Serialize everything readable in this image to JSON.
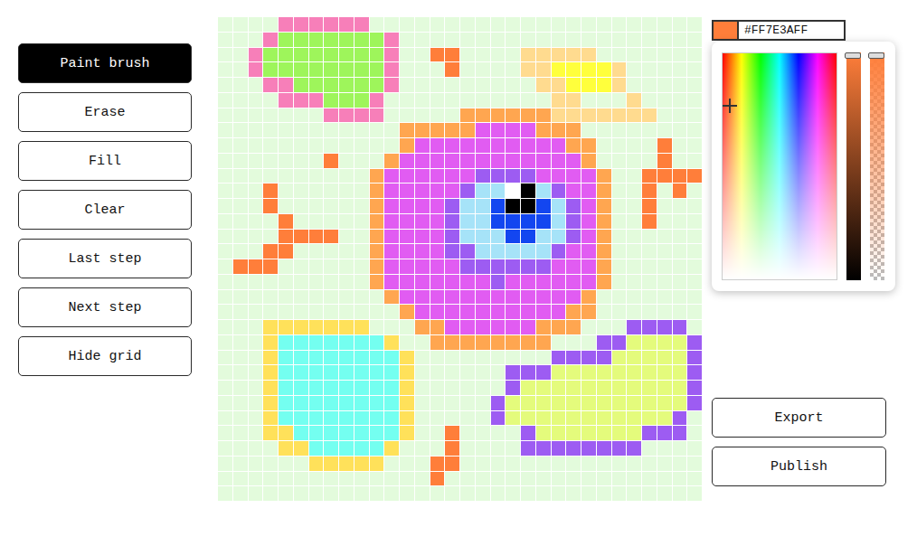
{
  "tools": [
    {
      "label": "Paint brush",
      "selected": true
    },
    {
      "label": "Erase",
      "selected": false
    },
    {
      "label": "Fill",
      "selected": false
    },
    {
      "label": "Clear",
      "selected": false
    },
    {
      "label": "Last step",
      "selected": false
    },
    {
      "label": "Next step",
      "selected": false
    },
    {
      "label": "Hide grid",
      "selected": false
    }
  ],
  "color": {
    "hex": "#FF7E3AFF"
  },
  "picker": {
    "open": true,
    "x": 0.06,
    "y": 0.23,
    "shade": 1,
    "alpha": 1
  },
  "canvas": {
    "palette": {
      ".": "#e3fbdc",
      "p": "#f77fb9",
      "g": "#9ef55b",
      "o": "#ff7e3a",
      "s": "#ffa650",
      "m": "#e15cf2",
      "v": "#9d5cf2",
      "l": "#a6e3f8",
      "b": "#1346f0",
      "k": "#000000",
      "w": "#ffffff",
      "t": "#ffdb8f",
      "y": "#ffff3c",
      "Y": "#ffe15a",
      "c": "#74fff0",
      "e": "#e4fb7c"
    },
    "rows": [
      "....pppppp",
      "...pgggggggp",
      "..pggggggggp..oo....ttttt",
      "..pggggggggp...o....ttyyyyt",
      "...ppggggggp.........ttyyyt",
      "....pppgggp...........tt...t",
      ".......pppp.....ssssssttttttt",
      "............sssssmmmmsss",
      "............smmmmmmmmmmss....o",
      ".......o...smmmmmmmmmmmms....o",
      "..........smmmmmmvvvvmmmms..oooo",
      "...o......smmmmmvllwklvmms..o.o",
      "...o......smmmmvllbkkblvms..o",
      "....o.....smmmmvllbbbblvms..o",
      "....oooo..smmmmvlllbbllvms",
      "...oo.....smmmmvvlllllvmms",
      ".ooo......smmmmmvvvvvvmmms",
      "..........smmmmmmmvmmmmmms",
      "...........smmmmmmmmmmmms",
      "............smmmmmmmmmmss",
      "...YYYYYYY...ssmmmmmmsss...vvvv",
      "...YcccccccY..ssssssss...vveeeev",
      "...YccccccccY.........vvvveeeeev",
      "...YccccccccY......vvveeeeeeeeev",
      "...YccccccccY......veeeeeeeeeeev",
      "...YccccccccY.....veeeeeeeeeeeev",
      "...YccccccccY.....veeeeeeeeeeev",
      "...YYcccccccY..o....veeeeeeevvv",
      "....YYcccccY...o....vvvvvvvv",
      "......YYYYY...oo",
      "..............o",
      ""
    ]
  },
  "actions": [
    "Export",
    "Publish"
  ]
}
